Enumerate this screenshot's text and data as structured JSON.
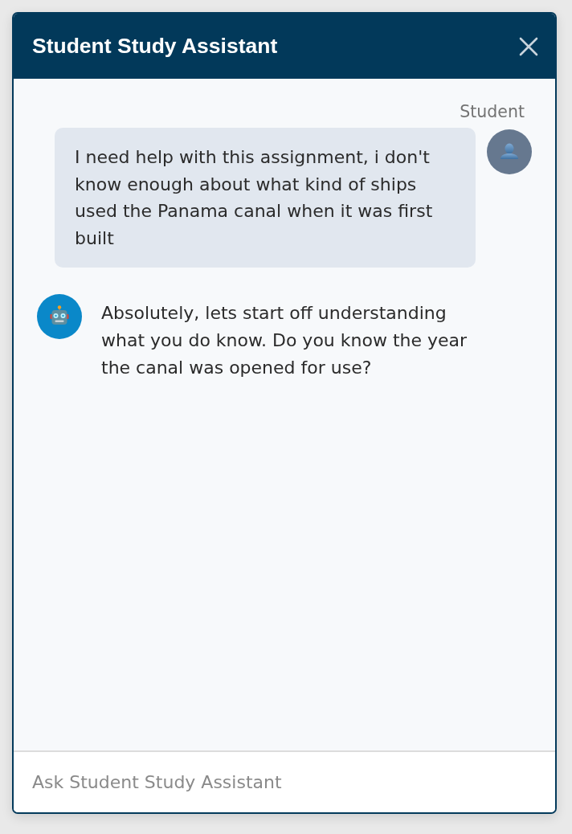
{
  "window": {
    "title": "Student Study Assistant"
  },
  "messages": [
    {
      "kind": "user",
      "sender": "Student",
      "text": "I need help with this assignment, i don't know enough about what kind of ships used the Panama canal when it was first built"
    },
    {
      "kind": "assistant",
      "text": "Absolutely, lets start off understanding what you do know. Do you know the year the canal was opened for use?"
    }
  ],
  "composer": {
    "placeholder": "Ask Student Study Assistant"
  }
}
